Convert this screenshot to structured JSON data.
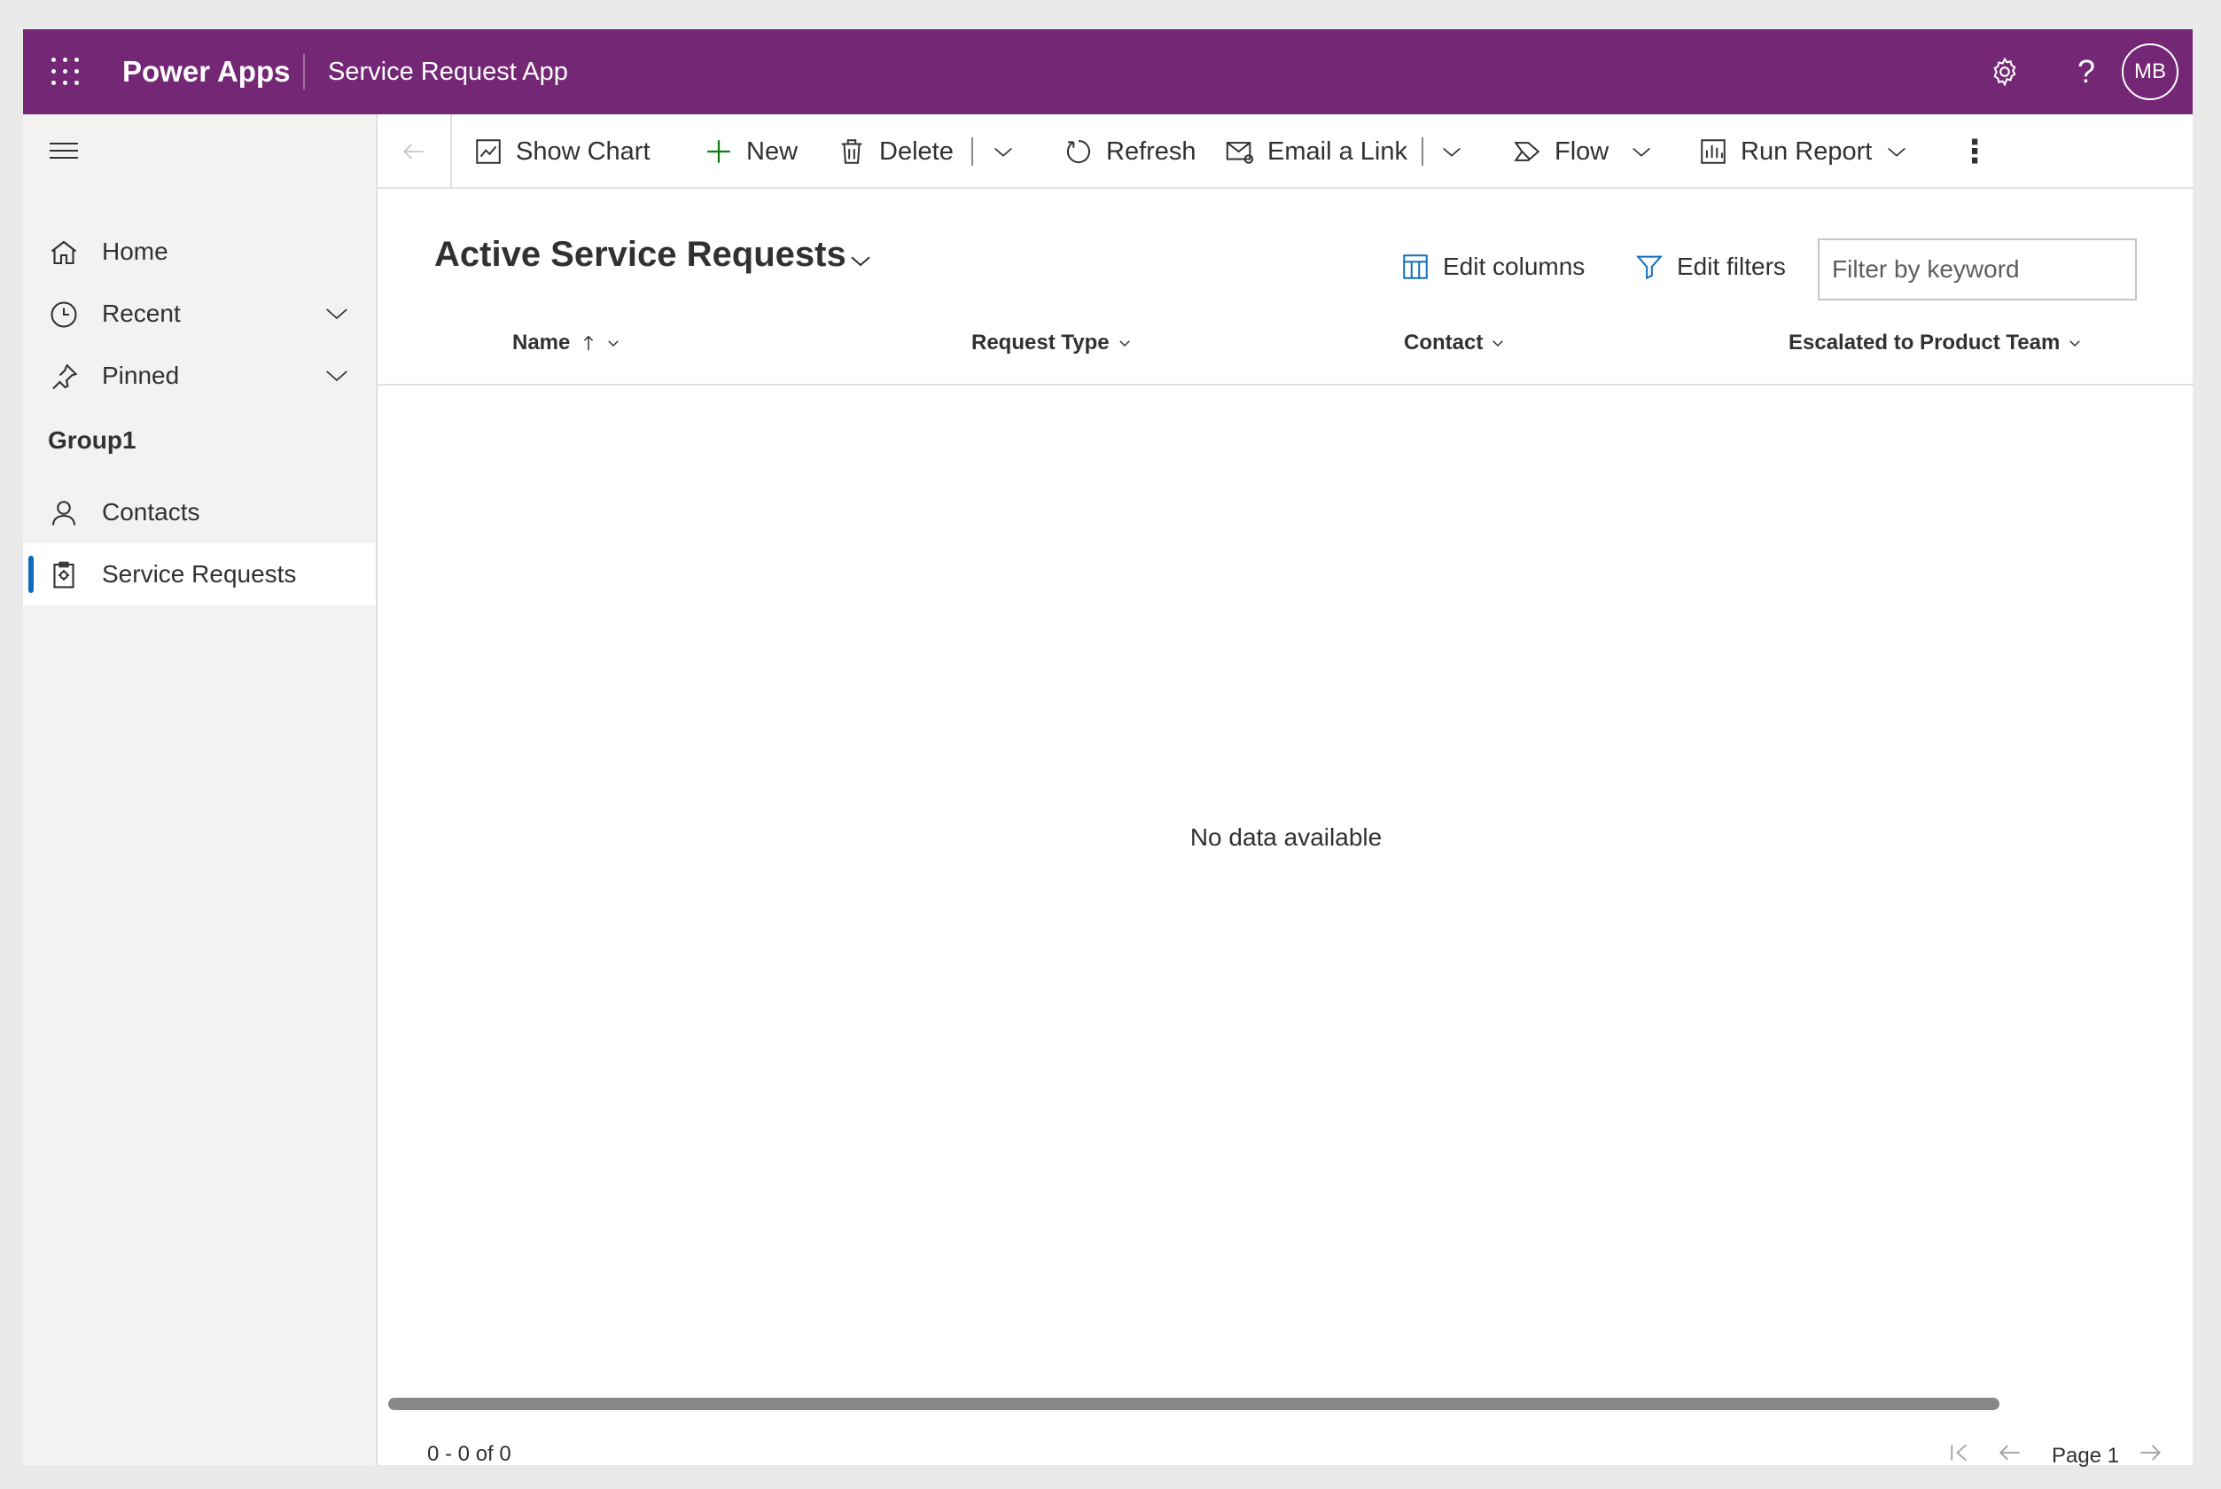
{
  "header": {
    "brand": "Power Apps",
    "app_name": "Service Request App",
    "avatar_initials": "MB",
    "background_color": "#742774"
  },
  "sidebar": {
    "items": [
      {
        "label": "Home",
        "icon": "home-icon"
      },
      {
        "label": "Recent",
        "icon": "clock-icon"
      },
      {
        "label": "Pinned",
        "icon": "pin-icon"
      }
    ],
    "group_title": "Group1",
    "group_items": [
      {
        "label": "Contacts",
        "icon": "person-icon"
      },
      {
        "label": "Service Requests",
        "icon": "clipboard-icon",
        "selected": true
      }
    ]
  },
  "commands": {
    "show_chart": "Show Chart",
    "new": "New",
    "delete": "Delete",
    "refresh": "Refresh",
    "email_link": "Email a Link",
    "flow": "Flow",
    "run_report": "Run Report"
  },
  "view": {
    "title": "Active Service Requests",
    "edit_columns": "Edit columns",
    "edit_filters": "Edit filters",
    "filter_placeholder": "Filter by keyword"
  },
  "grid": {
    "columns": [
      "Name",
      "Request Type",
      "Contact",
      "Escalated to Product Team"
    ],
    "sort_column": "Name",
    "empty_message": "No data available"
  },
  "footer": {
    "record_count": "0 - 0 of 0",
    "page_label": "Page 1"
  },
  "colors": {
    "accent": "#0f6cbd",
    "new_icon": "#107c10"
  }
}
